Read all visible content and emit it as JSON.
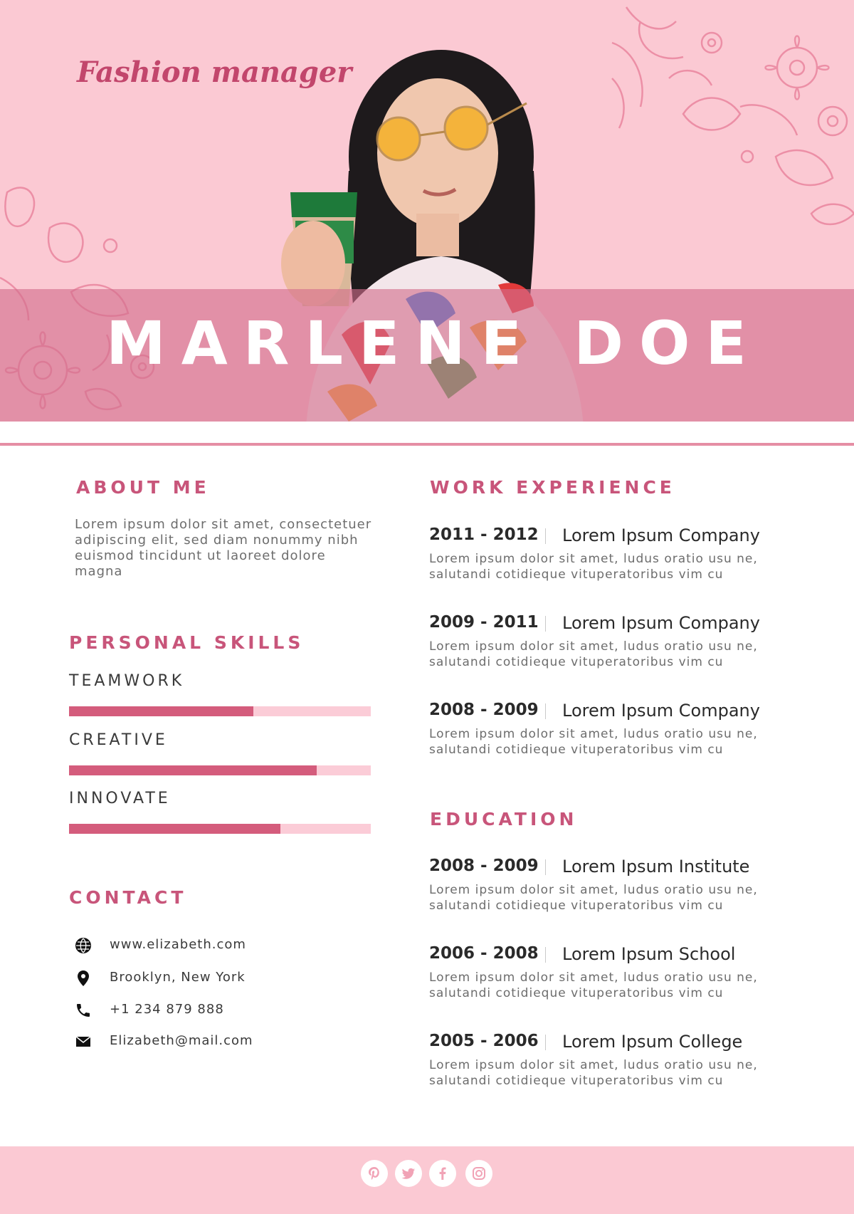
{
  "header": {
    "job_title": "Fashion manager",
    "name": "MARLENE DOE"
  },
  "about": {
    "heading": "ABOUT ME",
    "text": "Lorem ipsum dolor sit amet, consectetuer adipiscing elit, sed diam nonummy nibh euismod tincidunt ut laoreet dolore magna"
  },
  "skills": {
    "heading": "PERSONAL SKILLS",
    "items": [
      {
        "label": "TEAMWORK",
        "level": 0.61
      },
      {
        "label": "CREATIVE",
        "level": 0.82
      },
      {
        "label": "INNOVATE",
        "level": 0.7
      }
    ]
  },
  "contact": {
    "heading": "CONTACT",
    "items": [
      {
        "icon": "globe-icon",
        "text": "www.elizabeth.com"
      },
      {
        "icon": "location-pin-icon",
        "text": "Brooklyn, New York"
      },
      {
        "icon": "phone-icon",
        "text": "+1 234 879 888"
      },
      {
        "icon": "envelope-icon",
        "text": "Elizabeth@mail.com"
      }
    ]
  },
  "work": {
    "heading": "WORK EXPERIENCE",
    "items": [
      {
        "years": "2011 - 2012",
        "org": "Lorem Ipsum Company",
        "desc": "Lorem ipsum dolor sit amet, ludus oratio usu ne, salutandi cotidieque vituperatoribus vim cu"
      },
      {
        "years": "2009 - 2011",
        "org": "Lorem Ipsum Company",
        "desc": "Lorem ipsum dolor sit amet, ludus oratio usu ne, salutandi cotidieque vituperatoribus vim cu"
      },
      {
        "years": "2008 - 2009",
        "org": "Lorem Ipsum Company",
        "desc": "Lorem ipsum dolor sit amet, ludus oratio usu ne, salutandi cotidieque vituperatoribus vim cu"
      }
    ]
  },
  "education": {
    "heading": "EDUCATION",
    "items": [
      {
        "years": "2008 - 2009",
        "org": "Lorem Ipsum Institute",
        "desc": "Lorem ipsum dolor sit amet, ludus oratio usu ne, salutandi cotidieque vituperatoribus vim cu"
      },
      {
        "years": "2006 - 2008",
        "org": "Lorem Ipsum School",
        "desc": "Lorem ipsum dolor sit amet, ludus oratio usu ne, salutandi cotidieque vituperatoribus vim cu"
      },
      {
        "years": "2005 - 2006",
        "org": "Lorem Ipsum College",
        "desc": "Lorem ipsum dolor sit amet, ludus oratio usu ne, salutandi cotidieque vituperatoribus vim cu"
      }
    ]
  },
  "footer": {
    "social": [
      "pinterest-icon",
      "twitter-icon",
      "facebook-icon",
      "instagram-icon"
    ]
  },
  "colors": {
    "accent": "#c8557a",
    "bar_fill": "#d45c7c",
    "bar_track": "#fbccd7",
    "hero_background": "#fbc9d3"
  }
}
